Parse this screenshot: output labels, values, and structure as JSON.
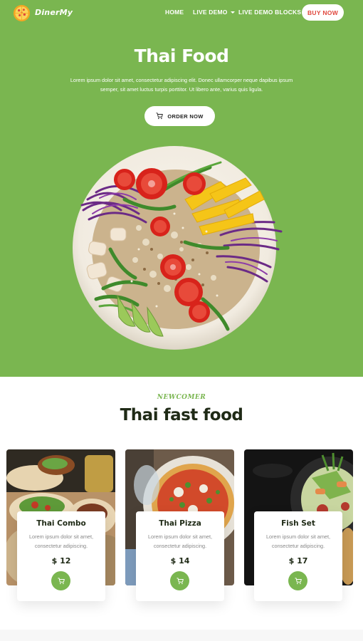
{
  "brand": {
    "name": "DinerMy"
  },
  "nav": {
    "items": [
      {
        "label": "HOME"
      },
      {
        "label": "LIVE DEMO"
      },
      {
        "label": "LIVE DEMO BLOCKS"
      }
    ],
    "buy_label": "BUY NOW"
  },
  "hero": {
    "title": "Thai Food",
    "description": "Lorem ipsum dolor sit amet, consectetur adipiscing elit. Donec ullamcorper neque dapibus ipsum semper, sit amet luctus turpis porttitor. Ut libero ante, varius quis ligula.",
    "order_label": "ORDER NOW"
  },
  "section": {
    "subtitle": "NEWCOMER",
    "title": "Thai fast food"
  },
  "cards": [
    {
      "name": "Thai Combo",
      "desc": "Lorem ipsum dolor sit amet, consectetur adipiscing.",
      "price": "$ 12"
    },
    {
      "name": "Thai Pizza",
      "desc": "Lorem ipsum dolor sit amet, consectetur adipiscing.",
      "price": "$ 14"
    },
    {
      "name": "Fish Set",
      "desc": "Lorem ipsum dolor sit amet, consectetur adipiscing.",
      "price": "$ 17"
    }
  ],
  "colors": {
    "accent": "#7ab650",
    "buy_text": "#e0473d",
    "heading": "#1f2a16"
  },
  "icons": [
    "pizza-logo-icon",
    "cart-icon",
    "chevron-down-icon"
  ]
}
